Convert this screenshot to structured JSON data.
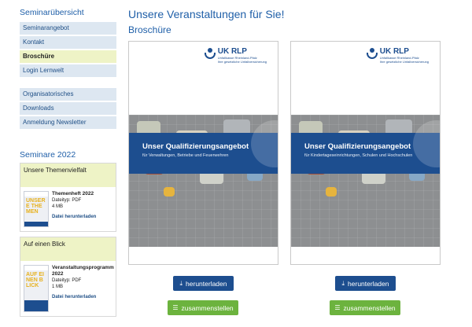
{
  "sidebar": {
    "title": "Seminarübersicht",
    "nav_primary": [
      "Seminarangebot",
      "Kontakt",
      "Broschüre",
      "Login Lernwelt"
    ],
    "nav_secondary": [
      "Organisatorisches",
      "Downloads",
      "Anmeldung Newsletter"
    ],
    "seminars_title": "Seminare 2022",
    "cards": [
      {
        "header": "Unsere Themenvielfalt",
        "name": "Themenheft 2022",
        "filetype": "Dateityp: PDF",
        "size": "4 MB",
        "link": "Datei herunterladen",
        "thumb_text": "UNSERE THEMEN"
      },
      {
        "header": "Auf einen Blick",
        "name": "Veranstaltungsprogramm 2022",
        "filetype": "Dateityp: PDF",
        "size": "1 MB",
        "link": "Datei herunterladen",
        "thumb_text": "AUF EINEN BLICK"
      }
    ]
  },
  "main": {
    "heading": "Unsere Veranstaltungen für Sie!",
    "subheading": "Broschüre",
    "brochures": [
      {
        "logo_name": "UK RLP",
        "logo_line1": "Unfallkasse Rheinland-Pfalz",
        "logo_line2": "Ihre gesetzliche Unfallversicherung",
        "title": "Unser Qualifizierungsangebot",
        "subtitle": "für Verwaltungen, Betriebe und Feuerwehren",
        "download_label": "herunterladen",
        "add_label": "zusammenstellen"
      },
      {
        "logo_name": "UK RLP",
        "logo_line1": "Unfallkasse Rheinland-Pfalz",
        "logo_line2": "Ihre gesetzliche Unfallversicherung",
        "title": "Unser Qualifizierungsangebot",
        "subtitle": "für Kindertageseinrichtungen, Schulen und Hochschulen",
        "download_label": "herunterladen",
        "add_label": "zusammenstellen"
      }
    ]
  },
  "colors": {
    "brand_blue": "#1d4e8f",
    "active_nav": "#eef3c6",
    "nav_bg": "#dde7f1",
    "button_green": "#6cb33e"
  },
  "icons": {
    "download": "download-icon",
    "add": "list-icon"
  }
}
